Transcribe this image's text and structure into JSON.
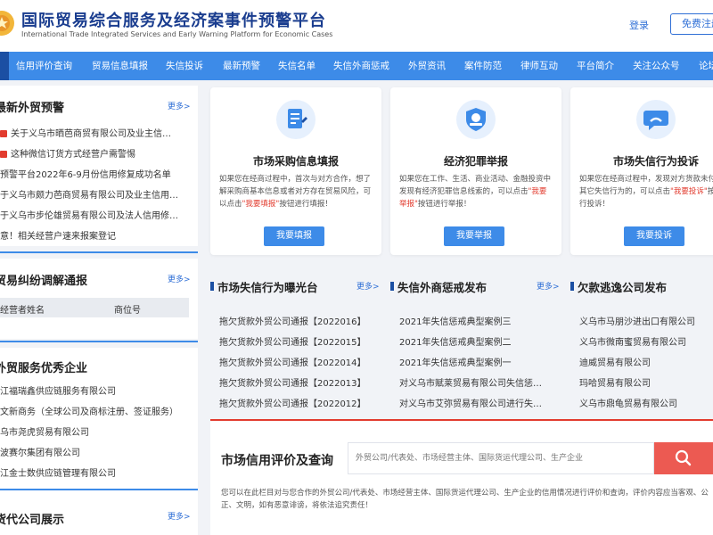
{
  "header": {
    "title": "国际贸易综合服务及经济案事件预警平台",
    "subtitle": "International Trade Integrated Services and Early Warning Platform for Economic Cases",
    "login": "登录",
    "register": "免费注册"
  },
  "nav": [
    "信用评价查询",
    "贸易信息填报",
    "失信投诉",
    "最新预警",
    "失信名单",
    "失信外商惩戒",
    "外贸资讯",
    "案件防范",
    "律师互动",
    "平台简介",
    "关注公众号",
    "论坛"
  ],
  "left": {
    "warn": {
      "title": "最新外贸预警",
      "more": "更多>",
      "items": [
        "关于义乌市晒芭商贸有限公司及业主信…",
        "这种微信订货方式经营户需警惕",
        "预警平台2022年6-9月份信用修复成功名单",
        "于义乌市颇力芭商贸易有限公司及业主信用…",
        "于义乌市步伦雄贸易有限公司及法人信用修…",
        "意！相关经营户速来报案登记"
      ]
    },
    "mediation": {
      "title": "贸易纠纷调解通报",
      "more": "更多>",
      "col1": "经营者姓名",
      "col2": "商位号"
    },
    "enterprise": {
      "title": "外贸服务优秀企业",
      "items": [
        "江福瑞鑫供应链服务有限公司",
        "文新商务（全球公司及商标注册、签证服务）",
        "乌市尧虎贸易有限公司",
        "波赛尔集团有限公司",
        "江金士数供应链管理有限公司"
      ]
    },
    "agency": {
      "title": "货代公司展示",
      "more": "更多>"
    }
  },
  "cards": [
    {
      "title": "市场采购信息填报",
      "desc_a": "如果您在经商过程中，首次与对方合作，想了解采购商基本信息或者对方存在贸易风险，可以点击",
      "highlight": "\"我要填报\"",
      "desc_b": "按钮进行填报！",
      "button": "我要填报",
      "icon": "document-edit-icon"
    },
    {
      "title": "经济犯罪举报",
      "desc_a": "如果您在工作、生活、商业活动、金融投资中发现有经济犯罪信息线索的，可以点击",
      "highlight": "\"我要举报\"",
      "desc_b": "按钮进行举报！",
      "button": "我要举报",
      "icon": "police-badge-icon"
    },
    {
      "title": "市场失信行为投诉",
      "desc_a": "如果您在经商过程中，发现对方货款未付或有其它失信行为的，可以点击",
      "highlight": "\"我要投诉\"",
      "desc_b": "按钮进行投诉！",
      "button": "我要投诉",
      "icon": "chat-bubble-icon"
    }
  ],
  "columns": [
    {
      "title": "市场失信行为曝光台",
      "more": "更多>",
      "items": [
        "拖欠货款外贸公司通报【2022016】",
        "拖欠货款外贸公司通报【2022015】",
        "拖欠货款外贸公司通报【2022014】",
        "拖欠货款外贸公司通报【2022013】",
        "拖欠货款外贸公司通报【2022012】"
      ]
    },
    {
      "title": "失信外商惩戒发布",
      "more": "更多>",
      "items": [
        "2021年失信惩戒典型案例三",
        "2021年失信惩戒典型案例二",
        "2021年失信惩戒典型案例一",
        "对义乌市赋莱贸易有限公司失信惩…",
        "对义乌市艾弥贸易有限公司进行失…"
      ]
    },
    {
      "title": "欠款逃逸公司发布",
      "items": [
        "义乌市马朋沙进出口有限公司",
        "义乌市微南蜜贸易有限公司",
        "迪威贸易有限公司",
        "玛哈贸易有限公司",
        "义乌市鼎龟贸易有限公司"
      ]
    }
  ],
  "search": {
    "title": "市场信用评价及查询",
    "placeholder": "外贸公司/代表处、市场经营主体、国际货运代理公司、生产企业",
    "note": "您可以在此栏目对与您合作的外贸公司/代表处、市场经营主体、国际货运代理公司、生产企业的信用情况进行评价和查询，评价内容应当客观、公正、文明，如有恶意诽谤，将依法追究责任！"
  },
  "colors": {
    "primary": "#3d8be8",
    "dark": "#1b4fa3",
    "red": "#e23b2e"
  }
}
